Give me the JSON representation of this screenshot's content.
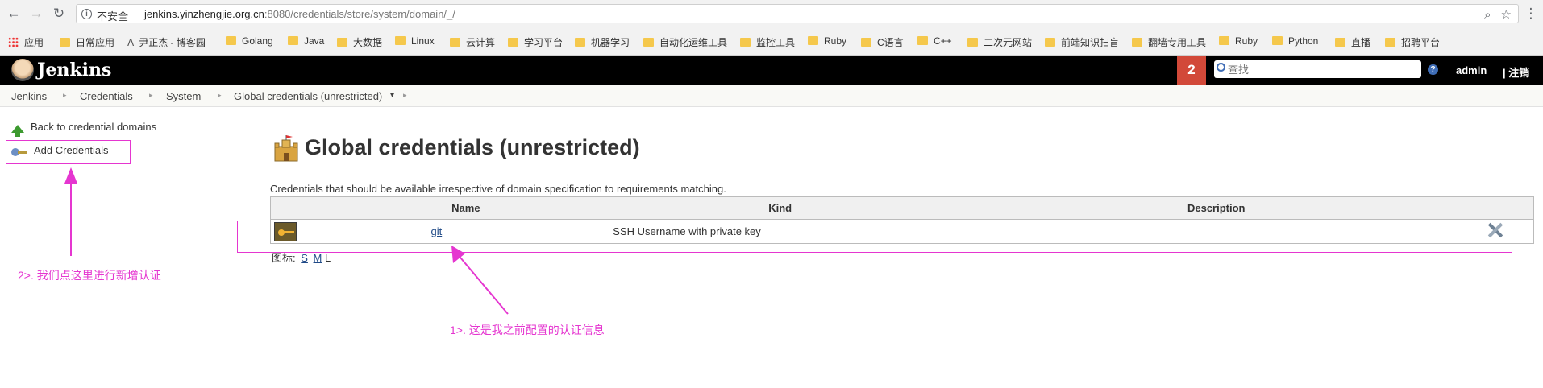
{
  "browser": {
    "insecure_label": "不安全",
    "url_host": "jenkins.yinzhengjie.org.cn",
    "url_rest": ":8080/credentials/store/system/domain/_/",
    "bookmarks": [
      "应用",
      "日常应用",
      "尹正杰 - 博客园",
      "Golang",
      "Java",
      "大数据",
      "Linux",
      "云计算",
      "学习平台",
      "机器学习",
      "自动化运维工具",
      "监控工具",
      "Ruby",
      "C语言",
      "C++",
      "二次元网站",
      "前端知识扫盲",
      "翻墙专用工具",
      "Ruby",
      "Python",
      "直播",
      "招聘平台"
    ]
  },
  "header": {
    "title": "Jenkins",
    "notification_count": "2",
    "search_placeholder": "查找",
    "help": "?",
    "user": "admin",
    "logout": "| 注销"
  },
  "breadcrumbs": [
    "Jenkins",
    "Credentials",
    "System",
    "Global credentials (unrestricted)"
  ],
  "sidebar": {
    "back_label": "Back to credential domains",
    "add_label": "Add Credentials"
  },
  "main": {
    "title": "Global credentials (unrestricted)",
    "description": "Credentials that should be available irrespective of domain specification to requirements matching.",
    "columns": [
      "Name",
      "Kind",
      "Description"
    ],
    "rows": [
      {
        "name": "git",
        "kind": "SSH Username with private key",
        "description": ""
      }
    ],
    "icon_size_label": "图标:",
    "icon_sizes": [
      "S",
      "M",
      "L"
    ]
  },
  "annotations": {
    "note_add": "2>. 我们点这里进行新增认证",
    "note_existing": "1>. 这是我之前配置的认证信息"
  },
  "colors": {
    "annotation": "#e536d0",
    "header_bg": "#000000",
    "badge": "#d24939"
  }
}
